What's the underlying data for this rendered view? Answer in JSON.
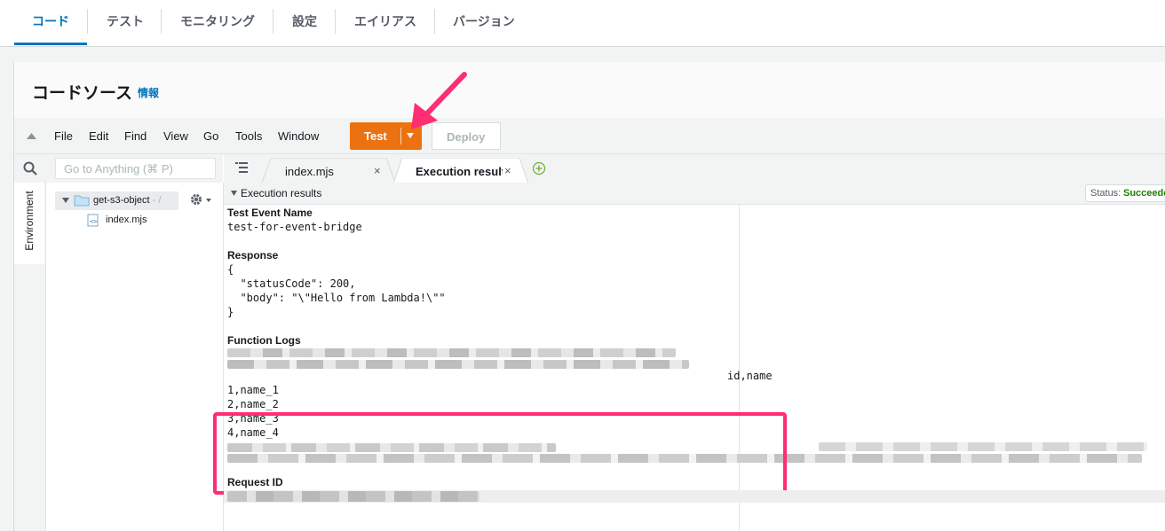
{
  "top_tabs": {
    "items": [
      {
        "label": "コード",
        "active": true
      },
      {
        "label": "テスト"
      },
      {
        "label": "モニタリング"
      },
      {
        "label": "設定"
      },
      {
        "label": "エイリアス"
      },
      {
        "label": "バージョン"
      }
    ]
  },
  "section": {
    "title": "コードソース",
    "info": "情報"
  },
  "menubar": {
    "items": [
      "File",
      "Edit",
      "Find",
      "View",
      "Go",
      "Tools",
      "Window"
    ],
    "test_label": "Test",
    "deploy_label": "Deploy"
  },
  "search": {
    "placeholder": "Go to Anything (⌘ P)"
  },
  "sidebar": {
    "environment_label": "Environment"
  },
  "filetree": {
    "folder": "get-s3-object",
    "folder_suffix": "- /",
    "file": "index.mjs"
  },
  "editor_tabs": [
    {
      "label": "index.mjs"
    },
    {
      "label": "Execution results",
      "active": true
    }
  ],
  "results": {
    "header": "Execution results",
    "status_label": "Status:",
    "status_value": "Succeeded",
    "test_event_label": "Test Event Name",
    "test_event_value": "test-for-event-bridge",
    "response_label": "Response",
    "response_lines": [
      "{",
      "  \"statusCode\": 200,",
      "  \"body\": \"\\\"Hello from Lambda!\\\"\"",
      "}"
    ],
    "function_logs_label": "Function Logs",
    "log_lines": [
      "id,name",
      "1,name_1",
      "2,name_2",
      "3,name_3",
      "4,name_4"
    ],
    "request_id_label": "Request ID"
  },
  "colors": {
    "accent": "#0073bb",
    "test_button": "#ec7211",
    "highlight": "#ff2d72",
    "success": "#1d8102"
  }
}
